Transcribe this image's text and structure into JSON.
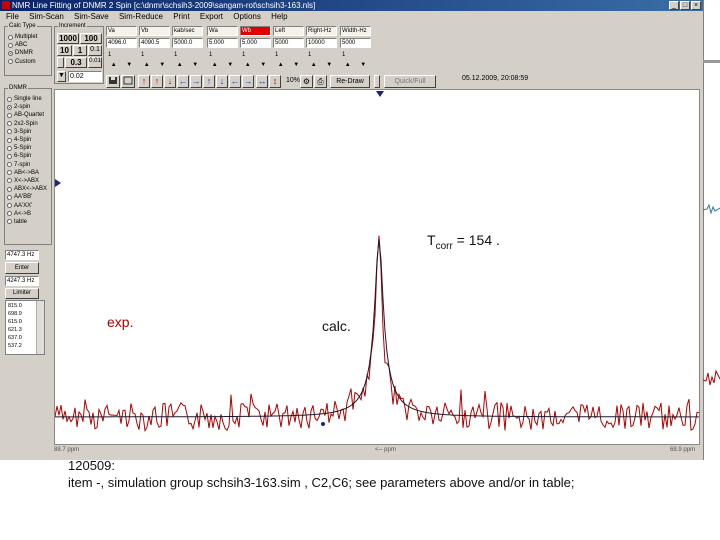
{
  "window": {
    "title": "NMR Line Fitting of DNMR 2 Spin [c:\\dnmr\\schsih3-2009\\sangam-rot\\schsih3-163.nls]",
    "controls": [
      "_",
      "□",
      "×"
    ]
  },
  "menu": [
    "File",
    "Sim-Scan",
    "Sim-Save",
    "Sim-Reduce",
    "Print",
    "Export",
    "Options",
    "Help"
  ],
  "calc_type": {
    "label": "Calc Type",
    "options": [
      {
        "label": "Multiplet",
        "selected": false
      },
      {
        "label": "ABC",
        "selected": false
      },
      {
        "label": "DNMR",
        "selected": true
      },
      {
        "label": "Custom",
        "selected": false
      }
    ]
  },
  "increment": {
    "label": "Increment",
    "buttons": [
      "1000",
      "100",
      "10",
      "1",
      "0.1",
      "0.3",
      "0.01"
    ],
    "value": "0.02"
  },
  "params": [
    {
      "label": "Va",
      "value": "4096.0"
    },
    {
      "label": "Vb",
      "value": "4090.5"
    },
    {
      "label": "kab/sec",
      "value": "5000.0"
    },
    {
      "label": "Wa",
      "value": "5.000"
    },
    {
      "label": "Wb",
      "value": "5.000"
    },
    {
      "label": "Left",
      "value": "5000"
    },
    {
      "label": "Right-Hz",
      "value": "10000"
    },
    {
      "label": "Width-Hz",
      "value": "5000"
    }
  ],
  "steps": [
    "1",
    "1",
    "1",
    "1",
    "1",
    "1",
    "1",
    "1"
  ],
  "toolbar": {
    "zoom": "10%",
    "redraw": "Re-Draw",
    "quickfull": "Quick/Full",
    "timestamp": "05.12.2009, 20:08:59"
  },
  "dnmr": {
    "label": "DNMR",
    "options": [
      {
        "label": "Single line",
        "selected": false
      },
      {
        "label": "2-spin",
        "selected": true
      },
      {
        "label": "AB-Quartet",
        "selected": false
      },
      {
        "label": "2x2-Spin",
        "selected": false
      },
      {
        "label": "3-Spin",
        "selected": false
      },
      {
        "label": "4-Spin",
        "selected": false
      },
      {
        "label": "5-Spin",
        "selected": false
      },
      {
        "label": "6-Spin",
        "selected": false
      },
      {
        "label": "7-spin",
        "selected": false
      },
      {
        "label": "AB<->BA",
        "selected": false
      },
      {
        "label": "X<->ABX",
        "selected": false
      },
      {
        "label": "ABX<->ABX",
        "selected": false
      },
      {
        "label": "AA'BB'",
        "selected": false
      },
      {
        "label": "AA'XX'",
        "selected": false
      },
      {
        "label": "A<->B",
        "selected": false
      },
      {
        "label": "table",
        "selected": false
      }
    ]
  },
  "freq": {
    "value1": "4747.3 Hz",
    "enter": "Enter",
    "value2": "4247.3 Hz",
    "limit": "Limiter"
  },
  "list_values": [
    "815.0",
    "698.9",
    "615.0",
    "621.3",
    "637.0",
    "537.2"
  ],
  "plot": {
    "tcorr_prefix": "T",
    "tcorr_sub": "corr",
    "tcorr_value": " = 154 .",
    "exp_label": "exp.",
    "calc_label": "calc.",
    "axis_left": "88.7 ppm",
    "axis_mid": "<-- ppm",
    "axis_right": "68.9 ppm"
  },
  "caption": {
    "line1": "120509:",
    "line2": "item -, simulation group schsih3-163.sim ,  C2,C6; see parameters above and/or in table;"
  },
  "colors": {
    "exp": "#b00000",
    "calc": "#1a1a2e",
    "marker": "#1a237e",
    "title": "#0a246a"
  }
}
